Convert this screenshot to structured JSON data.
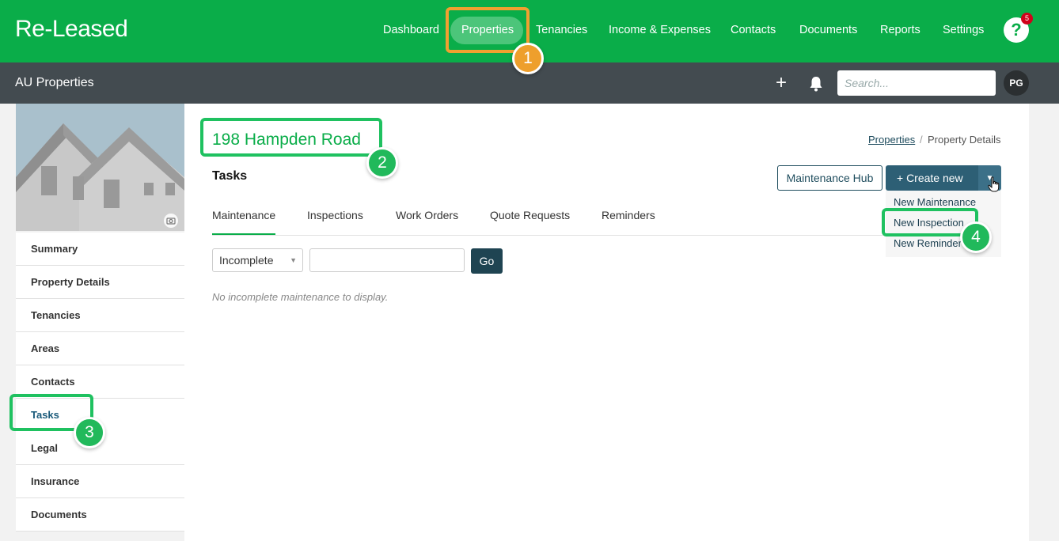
{
  "app": {
    "logo": "Re-Leased"
  },
  "topnav": [
    {
      "label": "Dashboard"
    },
    {
      "label": "Properties"
    },
    {
      "label": "Tenancies"
    },
    {
      "label": "Income & Expenses"
    },
    {
      "label": "Contacts"
    },
    {
      "label": "Documents"
    },
    {
      "label": "Reports"
    },
    {
      "label": "Settings"
    }
  ],
  "help": {
    "glyph": "?",
    "notification_count": "5"
  },
  "subbar": {
    "title": "AU Properties",
    "add_glyph": "+",
    "search_placeholder": "Search...",
    "avatar_initials": "PG"
  },
  "sidebar": {
    "items": [
      {
        "label": "Summary"
      },
      {
        "label": "Property Details"
      },
      {
        "label": "Tenancies"
      },
      {
        "label": "Areas"
      },
      {
        "label": "Contacts"
      },
      {
        "label": "Tasks"
      },
      {
        "label": "Legal"
      },
      {
        "label": "Insurance"
      },
      {
        "label": "Documents"
      }
    ],
    "active": "Tasks"
  },
  "page": {
    "property_name": "198 Hampden Road",
    "breadcrumb": {
      "link": "Properties",
      "separator": "/",
      "current": "Property Details"
    },
    "section_title": "Tasks",
    "maintenance_hub_label": "Maintenance Hub",
    "create_new_label": "+   Create new",
    "create_menu": [
      "New Maintenance",
      "New Inspection",
      "New Reminder"
    ],
    "tabs": [
      "Maintenance",
      "Inspections",
      "Work Orders",
      "Quote Requests",
      "Reminders"
    ],
    "active_tab": "Maintenance",
    "filter": {
      "selected": "Incomplete",
      "go_label": "Go"
    },
    "empty_message": "No incomplete maintenance to display."
  },
  "callouts": [
    "1",
    "2",
    "3",
    "4"
  ],
  "colors": {
    "brand_green": "#0aad49",
    "subbar": "#434b50",
    "button_primary": "#2d5f75",
    "callout_orange": "#ee9f2c",
    "callout_green": "#21b95b"
  }
}
